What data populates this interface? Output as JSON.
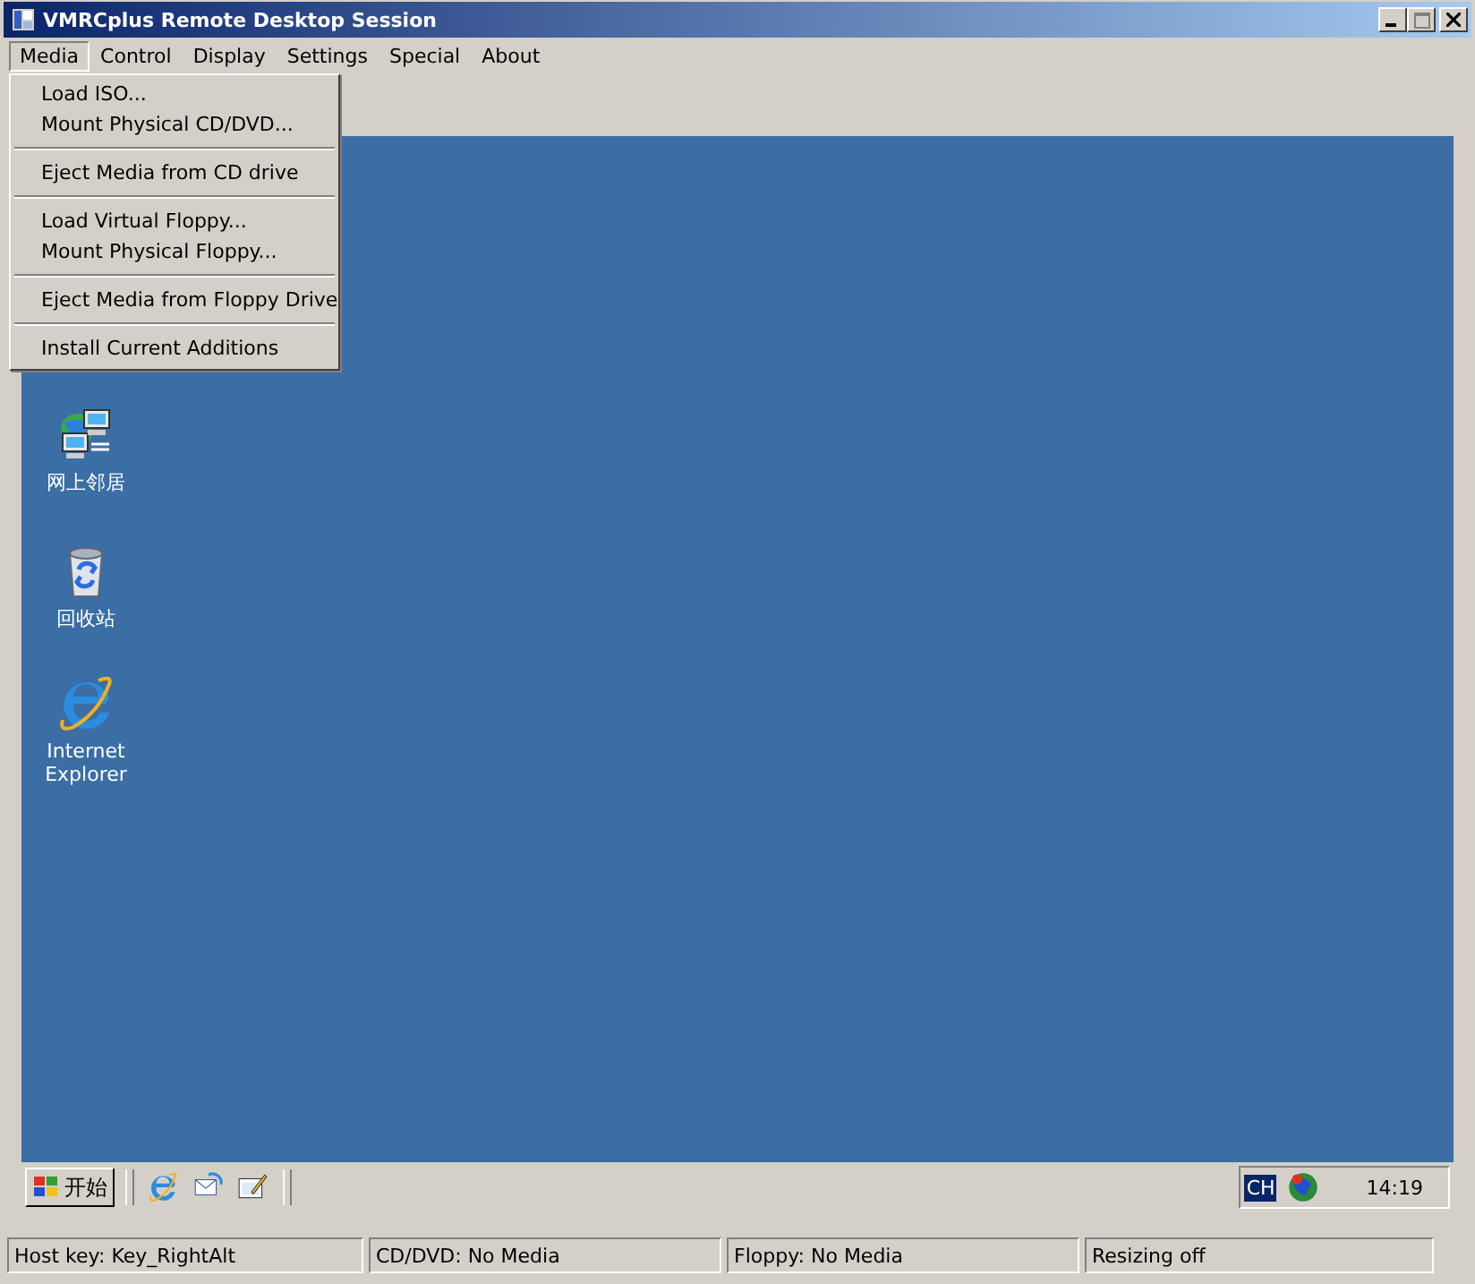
{
  "window": {
    "title": "VMRCplus Remote Desktop Session"
  },
  "menu_bar": [
    {
      "label": "Media",
      "selected": true
    },
    {
      "label": "Control",
      "selected": false
    },
    {
      "label": "Display",
      "selected": false
    },
    {
      "label": "Settings",
      "selected": false
    },
    {
      "label": "Special",
      "selected": false
    },
    {
      "label": "About",
      "selected": false
    }
  ],
  "open_menu": {
    "items": [
      {
        "kind": "item",
        "label": "Load ISO..."
      },
      {
        "kind": "item",
        "label": "Mount Physical CD/DVD..."
      },
      {
        "kind": "separator"
      },
      {
        "kind": "item",
        "label": "Eject Media from CD drive"
      },
      {
        "kind": "separator"
      },
      {
        "kind": "item",
        "label": "Load Virtual Floppy..."
      },
      {
        "kind": "item",
        "label": "Mount Physical Floppy..."
      },
      {
        "kind": "separator"
      },
      {
        "kind": "item",
        "label": "Eject Media from Floppy Drive"
      },
      {
        "kind": "separator"
      },
      {
        "kind": "item",
        "label": "Install Current Additions"
      }
    ]
  },
  "desktop": {
    "icons": [
      {
        "kind": "network",
        "label": "网上邻居"
      },
      {
        "kind": "recycle",
        "label": "回收站"
      },
      {
        "kind": "browser",
        "label": "Internet Explorer"
      }
    ]
  },
  "taskbar": {
    "start_label": "开始",
    "quick_launch": [
      {
        "kind": "browser"
      },
      {
        "kind": "outlook"
      },
      {
        "kind": "desktop"
      }
    ],
    "language": "CH",
    "clock": "14:19"
  },
  "status_bar": [
    {
      "text": "Host key: Key_RightAlt"
    },
    {
      "text": "CD/DVD: No Media"
    },
    {
      "text": "Floppy: No Media"
    },
    {
      "text": "Resizing off"
    }
  ]
}
